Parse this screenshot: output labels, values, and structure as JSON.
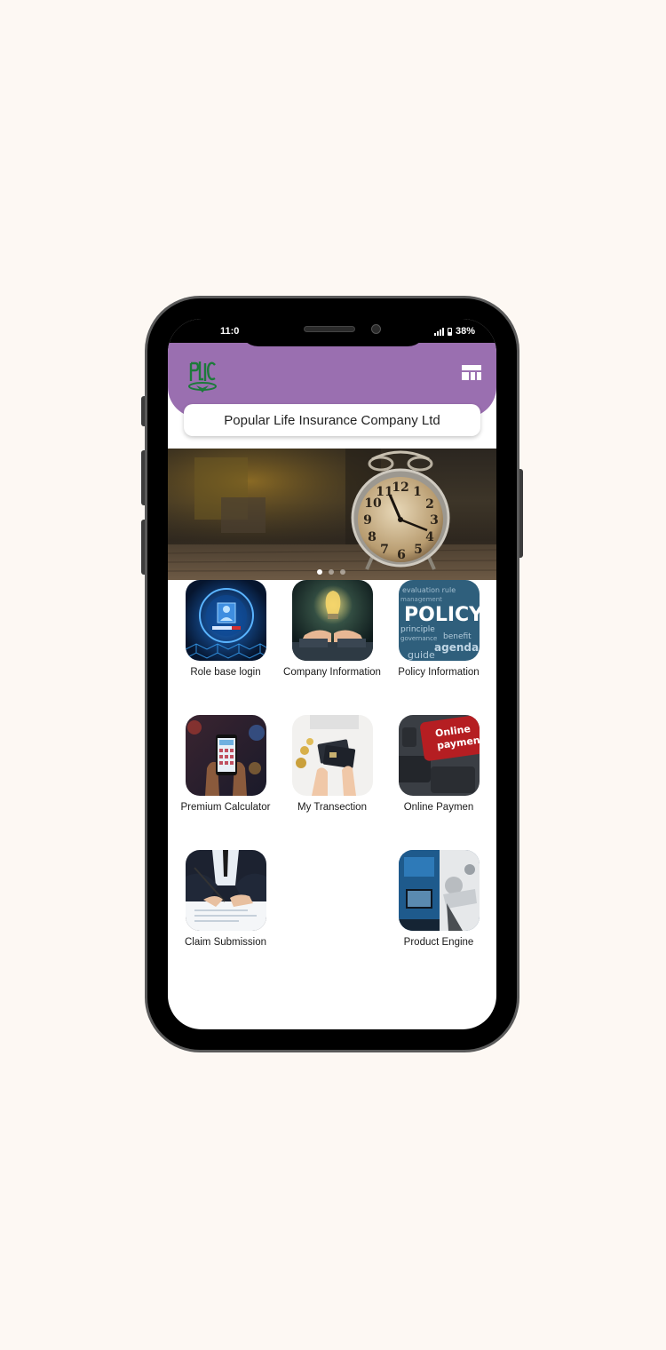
{
  "status_bar": {
    "time": "11:0",
    "battery": "38%"
  },
  "header": {
    "logo_icon": "plic-logo-icon",
    "menu_icon": "dashboard-layout-icon",
    "accent_color": "#9a6fb0"
  },
  "company_name": "Popular Life Insurance Company Ltd",
  "banner": {
    "image": "vintage-alarm-clock",
    "slide_count": 3,
    "active_slide": 1
  },
  "menu": {
    "items": [
      {
        "label": "Role base login",
        "icon": "login-hologram-image"
      },
      {
        "label": "Company Information",
        "icon": "lightbulb-hands-image"
      },
      {
        "label": "Policy Information",
        "icon": "policy-word-cloud-image"
      },
      {
        "label": "Premium Calculator",
        "icon": "phone-calculator-image"
      },
      {
        "label": "My Transection",
        "icon": "credit-cards-image"
      },
      {
        "label": "Online Paymen",
        "icon": "online-payment-key-image",
        "key_text_1": "Online",
        "key_text_2": "payment"
      },
      {
        "label": "Claim Submission",
        "icon": "signing-document-image"
      },
      {
        "label": "Product Engine",
        "icon": "product-engine-image"
      }
    ]
  }
}
